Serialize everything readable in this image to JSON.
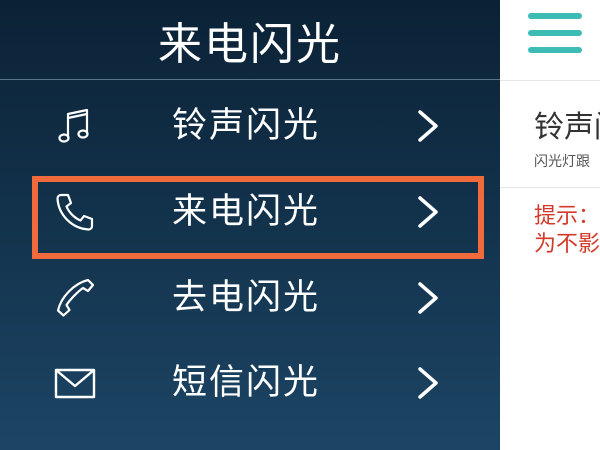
{
  "drawer": {
    "title": "来电闪光",
    "items": [
      {
        "label": "铃声闪光",
        "icon": "music-note-icon"
      },
      {
        "label": "来电闪光",
        "icon": "phone-icon",
        "highlighted": true
      },
      {
        "label": "去电闪光",
        "icon": "outgoing-phone-icon"
      },
      {
        "label": "短信闪光",
        "icon": "envelope-icon"
      }
    ]
  },
  "main": {
    "menu_icon": "hamburger-menu-icon",
    "title": "铃声闪",
    "subtitle": "闪光灯跟",
    "tip_line1": "提示：",
    "tip_line2": "为不影"
  },
  "colors": {
    "drawer_bg_top": "#0b2236",
    "drawer_bg_bottom": "#1c4565",
    "highlight_border": "#f06a3c",
    "accent": "#3dbcb5",
    "tip_text": "#d23a2a"
  }
}
